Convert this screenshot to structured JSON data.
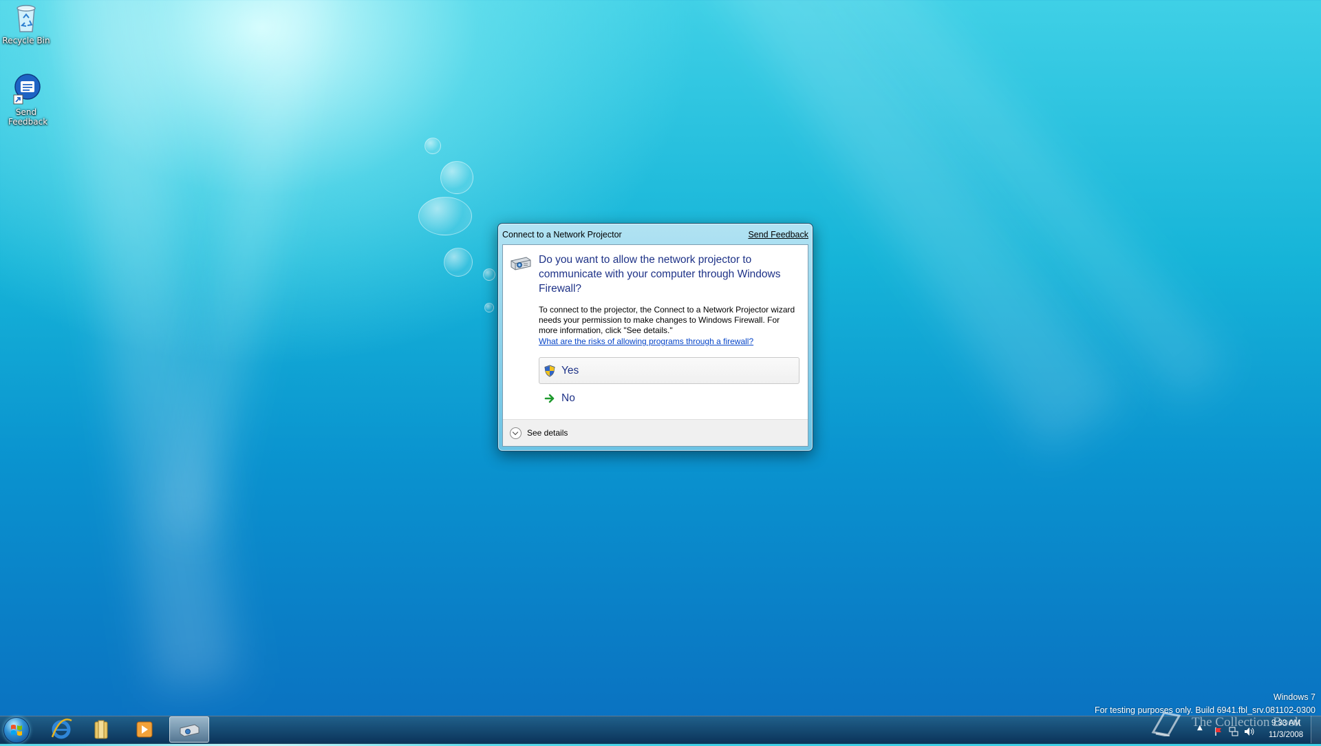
{
  "desktop": {
    "icons": [
      {
        "label": "Recycle Bin",
        "icon": "recycle-bin-icon"
      },
      {
        "label": "Send Feedback",
        "icon": "send-feedback-icon"
      }
    ]
  },
  "dialog": {
    "title": "Connect to a Network Projector",
    "feedback_link": "Send Feedback",
    "heading": "Do you want to allow the network projector to communicate with your computer through Windows Firewall?",
    "body": "To connect to the projector, the Connect to a Network Projector wizard needs your permission to make changes to Windows Firewall. For more information, click \"See details.\"",
    "help_link": "What are the risks of allowing programs through a firewall?",
    "yes_label": "Yes",
    "no_label": "No",
    "details_label": "See details",
    "icon": "network-projector-icon",
    "heading_color": "#1e3287",
    "link_color": "#0645c8"
  },
  "watermark": {
    "os_name": "Windows 7",
    "build_line": "For testing purposes only. Build 6941.fbl_srv.081102-0300",
    "site": "The Collection Book"
  },
  "taskbar": {
    "items": [
      {
        "name": "internet-explorer",
        "icon": "internet-explorer-icon"
      },
      {
        "name": "windows-explorer",
        "icon": "folder-icon"
      },
      {
        "name": "media-player",
        "icon": "media-player-icon"
      },
      {
        "name": "network-projector",
        "icon": "network-projector-icon",
        "active": true
      }
    ],
    "clock": {
      "time": "9:33 AM",
      "date": "11/3/2008"
    }
  }
}
